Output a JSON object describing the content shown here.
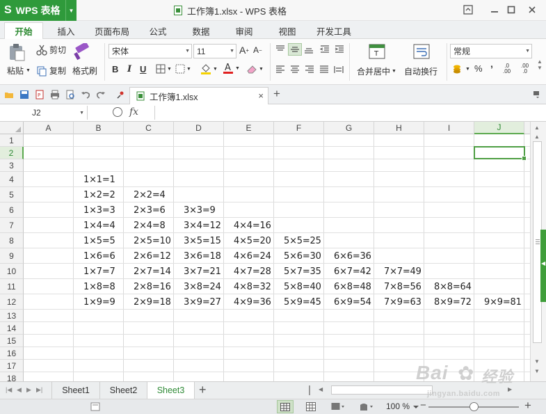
{
  "app": {
    "name": "WPS 表格",
    "logo": "S",
    "window_title": "工作簿1.xlsx - WPS 表格"
  },
  "ribbon_tabs": [
    "开始",
    "插入",
    "页面布局",
    "公式",
    "数据",
    "审阅",
    "视图",
    "开发工具"
  ],
  "ribbon": {
    "paste": "粘贴",
    "cut": "剪切",
    "copy": "复制",
    "format_painter": "格式刷",
    "font_name": "宋体",
    "font_size": "11",
    "bold": "B",
    "italic": "I",
    "underline": "U",
    "merge_center": "合并居中",
    "wrap_text": "自动换行",
    "number_format": "常规",
    "percent": "%",
    "comma": "’"
  },
  "doc_tab": {
    "name": "工作簿1.xlsx",
    "close": "×",
    "add": "+"
  },
  "formula_bar": {
    "name_box": "J2",
    "fx": "fx",
    "content": ""
  },
  "grid": {
    "columns": [
      "A",
      "B",
      "C",
      "D",
      "E",
      "F",
      "G",
      "H",
      "I",
      "J"
    ],
    "rows": [
      "1",
      "2",
      "3",
      "4",
      "5",
      "6",
      "7",
      "8",
      "9",
      "10",
      "11",
      "12",
      "13",
      "14",
      "15",
      "16",
      "17",
      "18"
    ],
    "selected_cell": "J2",
    "data_rows": [
      [
        "1×1=1"
      ],
      [
        "1×2=2",
        "2×2=4"
      ],
      [
        "1×3=3",
        "2×3=6",
        "3×3=9"
      ],
      [
        "1×4=4",
        "2×4=8",
        "3×4=12",
        "4×4=16"
      ],
      [
        "1×5=5",
        "2×5=10",
        "3×5=15",
        "4×5=20",
        "5×5=25"
      ],
      [
        "1×6=6",
        "2×6=12",
        "3×6=18",
        "4×6=24",
        "5×6=30",
        "6×6=36"
      ],
      [
        "1×7=7",
        "2×7=14",
        "3×7=21",
        "4×7=28",
        "5×7=35",
        "6×7=42",
        "7×7=49"
      ],
      [
        "1×8=8",
        "2×8=16",
        "3×8=24",
        "4×8=32",
        "5×8=40",
        "6×8=48",
        "7×8=56",
        "8×8=64"
      ],
      [
        "1×9=9",
        "2×9=18",
        "3×9=27",
        "4×9=36",
        "5×9=45",
        "6×9=54",
        "7×9=63",
        "8×9=72",
        "9×9=81"
      ]
    ]
  },
  "sheets": [
    "Sheet1",
    "Sheet2",
    "Sheet3"
  ],
  "active_sheet": "Sheet3",
  "status": {
    "zoom": "100 %",
    "zoom_minus": "−",
    "zoom_plus": "+",
    "zoom_level": 0.5
  },
  "watermark": {
    "brand": "Bai",
    "logo_text": "经验",
    "url": "jingyan.baidu.com"
  },
  "colors": {
    "accent": "#2f9a3b",
    "selection": "#4e9e43",
    "header_bg": "#f2f2f2"
  },
  "icons": [
    "cut-icon",
    "copy-icon",
    "format-painter-icon",
    "paste-icon",
    "search-icon",
    "close-icon",
    "plus-icon",
    "minimize-icon",
    "maximize-icon",
    "restore-icon"
  ]
}
